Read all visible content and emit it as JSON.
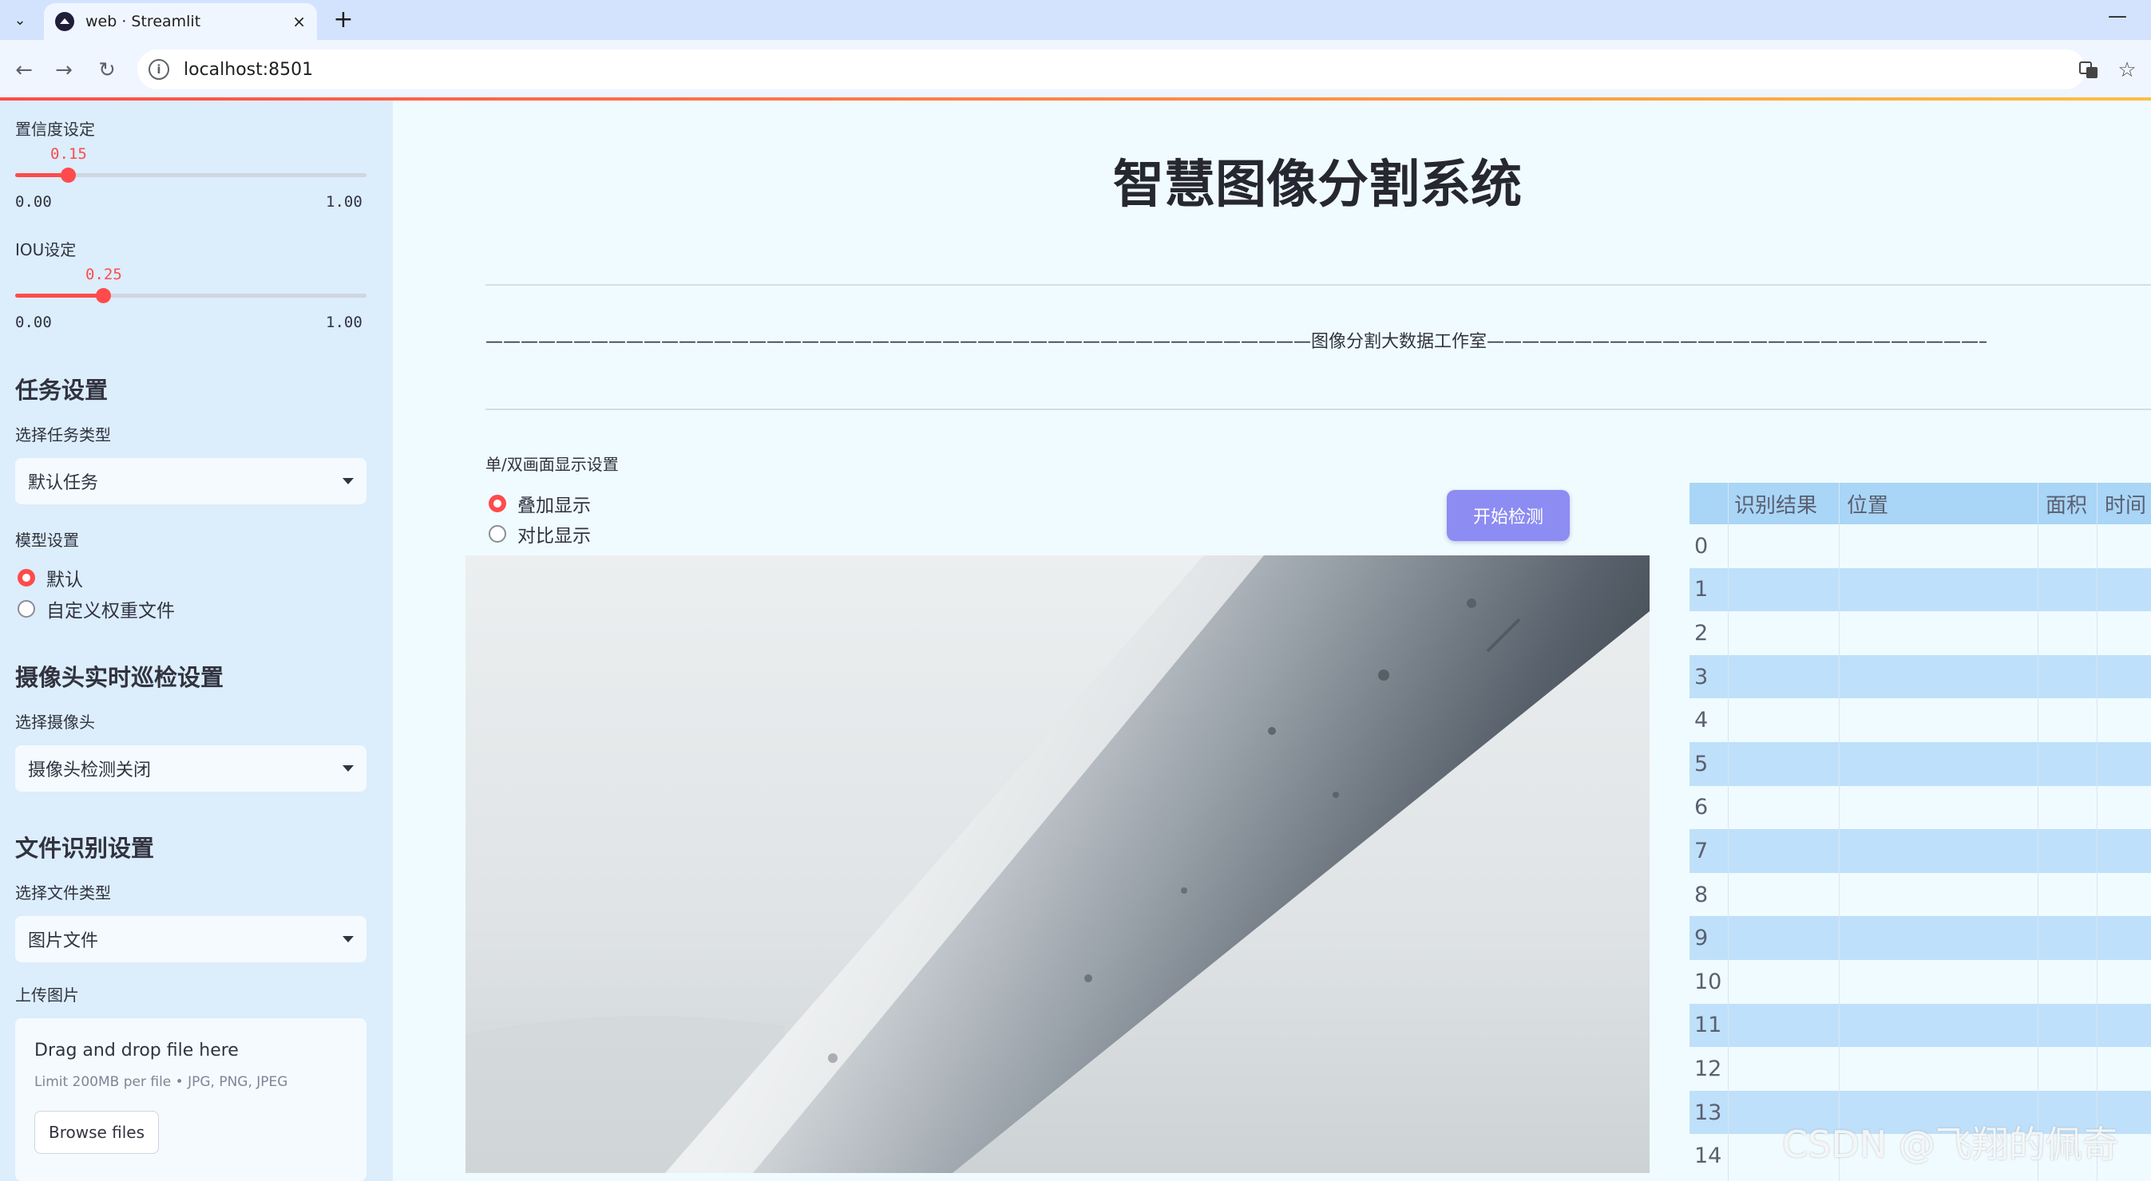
{
  "browser": {
    "tab_title": "web · Streamlit",
    "tab_close": "×",
    "new_tab": "+",
    "minimize": "—",
    "url": "localhost:8501"
  },
  "sidebar": {
    "confidence": {
      "label": "置信度设定",
      "value": 0.15,
      "value_text": "0.15",
      "min": "0.00",
      "max": "1.00"
    },
    "iou": {
      "label": "IOU设定",
      "value": 0.25,
      "value_text": "0.25",
      "min": "0.00",
      "max": "1.00"
    },
    "task_heading": "任务设置",
    "task_type_label": "选择任务类型",
    "task_type_value": "默认任务",
    "model_label": "模型设置",
    "model_options": [
      "默认",
      "自定义权重文件"
    ],
    "model_selected": 0,
    "camera_heading": "摄像头实时巡检设置",
    "camera_label": "选择摄像头",
    "camera_value": "摄像头检测关闭",
    "file_heading": "文件识别设置",
    "file_type_label": "选择文件类型",
    "file_type_value": "图片文件",
    "upload_label": "上传图片",
    "upload_title": "Drag and drop file here",
    "upload_sub": "Limit 200MB per file • JPG, PNG, JPEG",
    "upload_button": "Browse files"
  },
  "main": {
    "title": "智慧图像分割系统",
    "subtitle_line": "———————————————————————————————————————————————图像分割大数据工作室——————————————————————————————————————————————————",
    "display_label": "单/双画面显示设置",
    "display_options": [
      "叠加显示",
      "对比显示"
    ],
    "display_selected": 0,
    "start_button": "开始检测"
  },
  "table": {
    "headers": [
      "识别结果",
      "位置",
      "面积",
      "时间"
    ],
    "rows": [
      "0",
      "1",
      "2",
      "3",
      "4",
      "5",
      "6",
      "7",
      "8",
      "9",
      "10",
      "11",
      "12",
      "13",
      "14"
    ]
  },
  "watermark": "CSDN @飞翔的佩奇",
  "colors": {
    "accent": "#ff4b4b",
    "button": "#8d8cf3",
    "sidebar": "#dcedfc",
    "table_header": "#a9d5f7"
  }
}
